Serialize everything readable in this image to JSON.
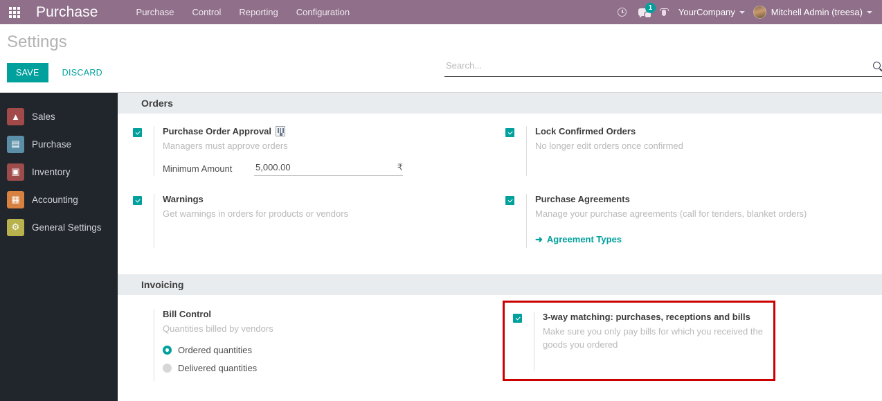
{
  "navbar": {
    "apps_icon": "grid-apps-icon",
    "brand": "Purchase",
    "menu": [
      "Purchase",
      "Control",
      "Reporting",
      "Configuration"
    ],
    "activity_icon": "clock-icon",
    "messages_icon": "chat-icon",
    "messages_count": "1",
    "debug_icon": "bug-icon",
    "company": "YourCompany",
    "user": "Mitchell Admin (treesa)",
    "accent_color": "#8f6f8a"
  },
  "control_panel": {
    "title": "Settings",
    "save_label": "SAVE",
    "discard_label": "DISCARD",
    "search_placeholder": "Search...",
    "search_value": "",
    "search_icon": "search-icon",
    "primary_color": "#00a09d"
  },
  "sidebar": {
    "items": [
      {
        "label": "Sales",
        "icon": "sales-app-icon",
        "icon_color": "#a24a4a",
        "glyph": "↗"
      },
      {
        "label": "Purchase",
        "icon": "purchase-app-icon",
        "icon_color": "#5b8fa8",
        "glyph": "▤"
      },
      {
        "label": "Inventory",
        "icon": "inventory-app-icon",
        "icon_color": "#9e4b4b",
        "glyph": "☗"
      },
      {
        "label": "Accounting",
        "icon": "accounting-app-icon",
        "icon_color": "#d88140",
        "glyph": "Ὄ4"
      },
      {
        "label": "General Settings",
        "icon": "general-settings-app-icon",
        "icon_color": "#b8b24e",
        "glyph": "⚙"
      }
    ]
  },
  "sections": {
    "orders": {
      "heading": "Orders",
      "purchase_order_approval": {
        "title": "Purchase Order Approval",
        "description": "Managers must approve orders",
        "checked": true,
        "company_icon": "multi-company-icon",
        "minimum_amount_label": "Minimum Amount",
        "minimum_amount_value": "5,000.00",
        "currency_symbol": "₹"
      },
      "lock_confirmed_orders": {
        "title": "Lock Confirmed Orders",
        "description": "No longer edit orders once confirmed",
        "checked": true
      },
      "warnings": {
        "title": "Warnings",
        "description": "Get warnings in orders for products or vendors",
        "checked": true
      },
      "purchase_agreements": {
        "title": "Purchase Agreements",
        "description": "Manage your purchase agreements (call for tenders, blanket orders)",
        "checked": true,
        "link_label": "Agreement Types",
        "link_icon": "arrow-right-icon"
      }
    },
    "invoicing": {
      "heading": "Invoicing",
      "bill_control": {
        "title": "Bill Control",
        "description": "Quantities billed by vendors",
        "options": [
          {
            "label": "Ordered quantities",
            "selected": true
          },
          {
            "label": "Delivered quantities",
            "selected": false
          }
        ]
      },
      "three_way_matching": {
        "title": "3-way matching: purchases, receptions and bills",
        "description": "Make sure you only pay bills for which you received the goods you ordered",
        "checked": true,
        "highlighted": true,
        "highlight_color": "#cc0000"
      }
    }
  }
}
